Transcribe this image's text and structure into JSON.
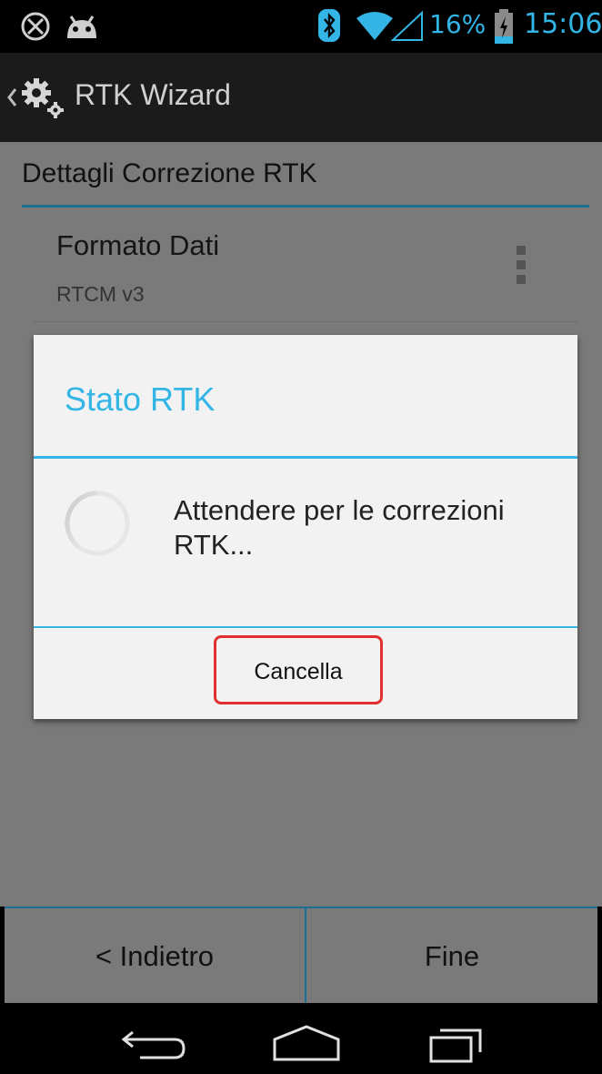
{
  "status_bar": {
    "icons": [
      "blocked-icon",
      "android-icon",
      "bluetooth-icon",
      "wifi-icon",
      "signal-icon",
      "battery-charging-icon"
    ],
    "battery": "16%",
    "time": "15:06"
  },
  "action_bar": {
    "title": "RTK Wizard",
    "icon": "gear-icon"
  },
  "content": {
    "section_header": "Dettagli Correzione RTK",
    "preference": {
      "title": "Formato Dati",
      "summary": "RTCM v3"
    }
  },
  "dialog": {
    "title": "Stato RTK",
    "message": "Attendere per le correzioni RTK...",
    "button": "Cancella"
  },
  "bottom_bar": {
    "back_label": "< Indietro",
    "finish_label": "Fine"
  },
  "nav_bar": {
    "icons": [
      "back-icon",
      "home-icon",
      "recents-icon"
    ]
  },
  "colors": {
    "accent": "#33b5e5",
    "highlight": "#e03030"
  }
}
